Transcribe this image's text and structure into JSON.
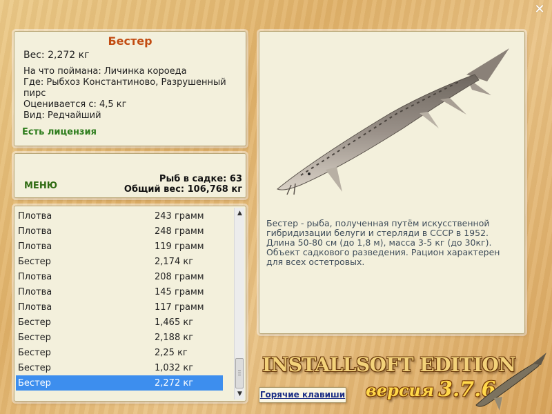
{
  "window": {
    "close_label": "✕"
  },
  "fish_info": {
    "title": "Бестер",
    "weight": "Вес: 2,272 кг",
    "bait": "На что поймана: Личинка короеда",
    "location": "Где: Рыбхоз Константиново, Разрушенный пирс",
    "price": "Оценивается с: 4,5 кг",
    "rarity": "Вид: Редчайший",
    "license": "Есть лицензия"
  },
  "menu_panel": {
    "menu_label": "МЕНЮ",
    "fish_count": "Рыб в садке: 63",
    "total_weight": "Общий вес: 106,768 кг"
  },
  "catch_list": {
    "items": [
      {
        "name": "Плотва",
        "weight": "243 грамм"
      },
      {
        "name": "Плотва",
        "weight": "248 грамм"
      },
      {
        "name": "Плотва",
        "weight": "119 грамм"
      },
      {
        "name": "Бестер",
        "weight": "2,174 кг"
      },
      {
        "name": "Плотва",
        "weight": "208 грамм"
      },
      {
        "name": "Плотва",
        "weight": "145 грамм"
      },
      {
        "name": "Плотва",
        "weight": "117 грамм"
      },
      {
        "name": "Бестер",
        "weight": "1,465 кг"
      },
      {
        "name": "Бестер",
        "weight": "2,188 кг"
      },
      {
        "name": "Бестер",
        "weight": "2,25 кг"
      },
      {
        "name": "Бестер",
        "weight": "1,032 кг"
      },
      {
        "name": "Бестер",
        "weight": "2,272 кг"
      }
    ],
    "selected_index": 11,
    "scroll_up_icon": "▲",
    "scroll_down_icon": "▼"
  },
  "description": {
    "text": "Бестер - рыба, полученная путём искусственной гибридизации белуги и стерляди в СССР в 1952. Длина 50-80 см (до 1,8 м), масса 3-5 кг (до 30кг). Объект садкового разведения. Рацион характерен для всех остетровых."
  },
  "logo": {
    "title": "INSTALLSOFT EDITION",
    "version_word": "версия",
    "version_number": "3.7.6"
  },
  "hotkeys_label": "Горячие клавиши"
}
